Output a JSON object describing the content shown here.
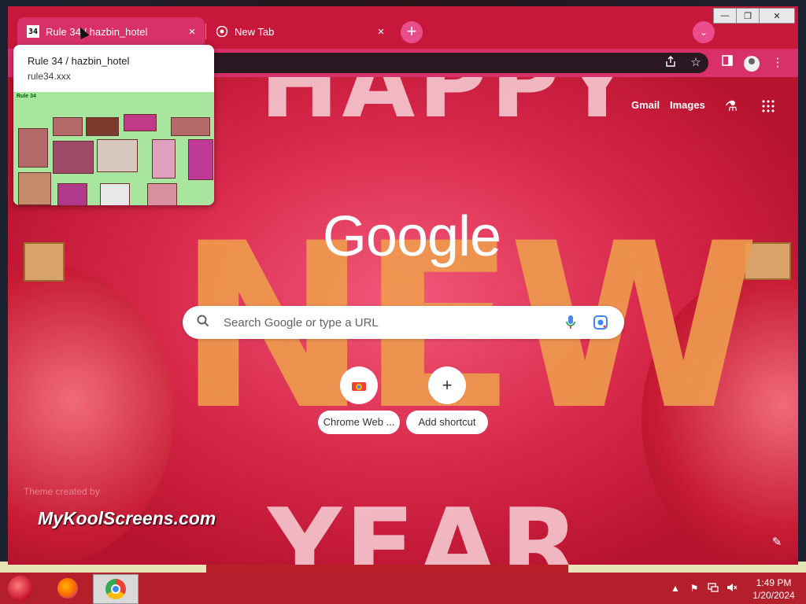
{
  "tabs": [
    {
      "title": "Rule 34 / hazbin_hotel",
      "favicon": "34",
      "close": "×"
    },
    {
      "title": "New Tab",
      "close": "×"
    }
  ],
  "window_controls": {
    "minimize": "—",
    "maximize": "❐",
    "close": "✕"
  },
  "tab_strip": {
    "new_tab": "+",
    "tab_search": "⌄"
  },
  "toolbar_icons": [
    "share-icon",
    "star-icon",
    "side-panel-icon",
    "profile-icon",
    "menu-icon"
  ],
  "hover_card": {
    "title": "Rule 34 / hazbin_hotel",
    "url": "rule34.xxx",
    "preview_header": "Rule 34"
  },
  "ntp": {
    "links": {
      "gmail": "Gmail",
      "images": "Images"
    },
    "logo": "Google",
    "search_placeholder": "Search Google or type a URL",
    "shortcuts": [
      {
        "label": "Chrome Web ...",
        "icon": "chrome-web-store-icon"
      },
      {
        "label": "Add shortcut",
        "icon": "plus-icon"
      }
    ],
    "theme_credit": "Theme created by",
    "background_text": {
      "top": "HAPPY",
      "middle": "NEW",
      "bottom": "YEAR"
    }
  },
  "watermark": "MyKoolScreens.com",
  "taskbar": {
    "apps": [
      "firefox",
      "chrome"
    ],
    "clock_time": "1:49 PM",
    "clock_date": "1/20/2024"
  },
  "colors": {
    "frame": "#c7173a",
    "active_tab": "#d8316a",
    "taskbar": "#b41f2c"
  }
}
